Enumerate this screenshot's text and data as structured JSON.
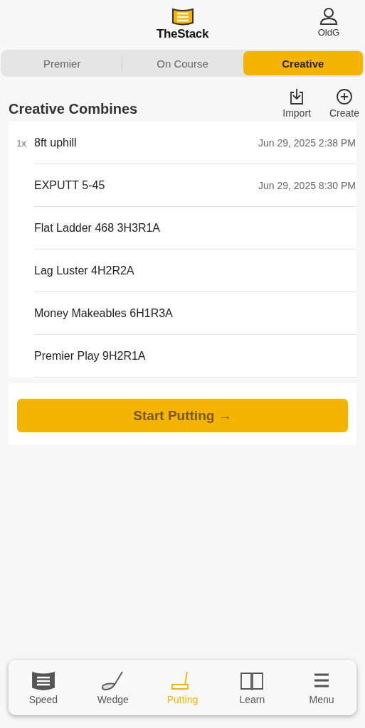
{
  "header": {
    "logo_text": "TheStack",
    "user": "OldG"
  },
  "tabs": [
    {
      "label": "Premier",
      "selected": false
    },
    {
      "label": "On Course",
      "selected": false
    },
    {
      "label": "Creative",
      "selected": true
    }
  ],
  "section": {
    "title": "Creative Combines",
    "actions": [
      {
        "kind": "import",
        "label": "Import"
      },
      {
        "kind": "create",
        "label": "Create"
      }
    ]
  },
  "combines": [
    {
      "count": "1x",
      "name": "8ft uphill",
      "date": "Jun 29, 2025 2:38 PM"
    },
    {
      "name": "EXPUTT 5-45",
      "date": "Jun 29, 2025 8:30 PM"
    },
    {
      "name": "Flat Ladder 468 3H3R1A"
    },
    {
      "name": "Lag Luster 4H2R2A"
    },
    {
      "name": "Money Makeables 6H1R3A"
    },
    {
      "name": "Premier Play 9H2R1A"
    }
  ],
  "start_button": {
    "label": "Start Putting",
    "arrow": "→",
    "disabled": true
  },
  "nav": [
    {
      "kind": "speed",
      "label": "Speed",
      "selected": false
    },
    {
      "kind": "wedge",
      "label": "Wedge",
      "selected": false
    },
    {
      "kind": "putting",
      "label": "Putting",
      "selected": true
    },
    {
      "kind": "learn",
      "label": "Learn",
      "selected": false
    },
    {
      "kind": "menu",
      "label": "Menu",
      "selected": false
    }
  ]
}
